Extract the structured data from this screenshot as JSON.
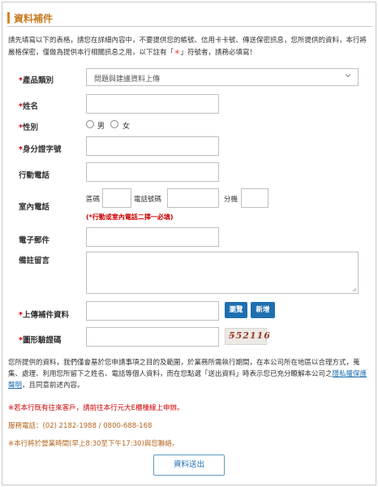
{
  "section": {
    "title": "資料補件"
  },
  "intro": {
    "text_before": "請先填寫以下的表格，請您在詳細內容中，不要提供您的帳號、信用卡卡號、傳送保密訊息，您所提供的資料，本行將嚴格保密，僅做為提供本行相關訊息之用，以下註有「",
    "star": "＊",
    "text_after": "」符號者，請務必填寫！"
  },
  "form": {
    "category": {
      "star": "*",
      "label": "產品類別",
      "value": "問題與建議資料上傳",
      "icon": "chevron-down-icon"
    },
    "name": {
      "star": "*",
      "label": "姓名"
    },
    "gender": {
      "star": "*",
      "label": "性別",
      "male": "男",
      "female": "女"
    },
    "id_number": {
      "star": "*",
      "label": "身分證字號"
    },
    "mobile": {
      "label": "行動電話"
    },
    "home_phone": {
      "label": "室內電話",
      "area_label": "區碼",
      "number_label": "電話號碼",
      "ext_label": "分機"
    },
    "phone_hint": "(*行動或室內電話二擇一必填)",
    "email": {
      "label": "電子郵件"
    },
    "remarks": {
      "label": "備註留言"
    },
    "upload": {
      "star": "*",
      "label": "上傳補件資料",
      "browse": "瀏覽",
      "add": "新增"
    },
    "captcha": {
      "star": "*",
      "label": "圖形驗證碼",
      "code": "5̶52116"
    }
  },
  "footer": {
    "consent_before": "您所提供的資料，我們僅會基於您申請事項之目的及範圍，於業務所需執行期間，在本公司所在地區以合理方式，蒐集、處理、利用您所留下之姓名、電話等個人資料，而在您點選「送出資料」時表示您已充分瞭解本公司之",
    "privacy_link": "隱私權保護聲明",
    "consent_after": "，且同意前述內容。",
    "note1": "※若本行既有往來客戶，請前往本行元大E櫃檯線上申辦。",
    "note2": "服務電話：(02) 2182-1988 / 0800-688-168",
    "note3": "※本行將於營業時間(早上8:30至下午17:30)與您聯絡。",
    "submit": "資料送出"
  }
}
